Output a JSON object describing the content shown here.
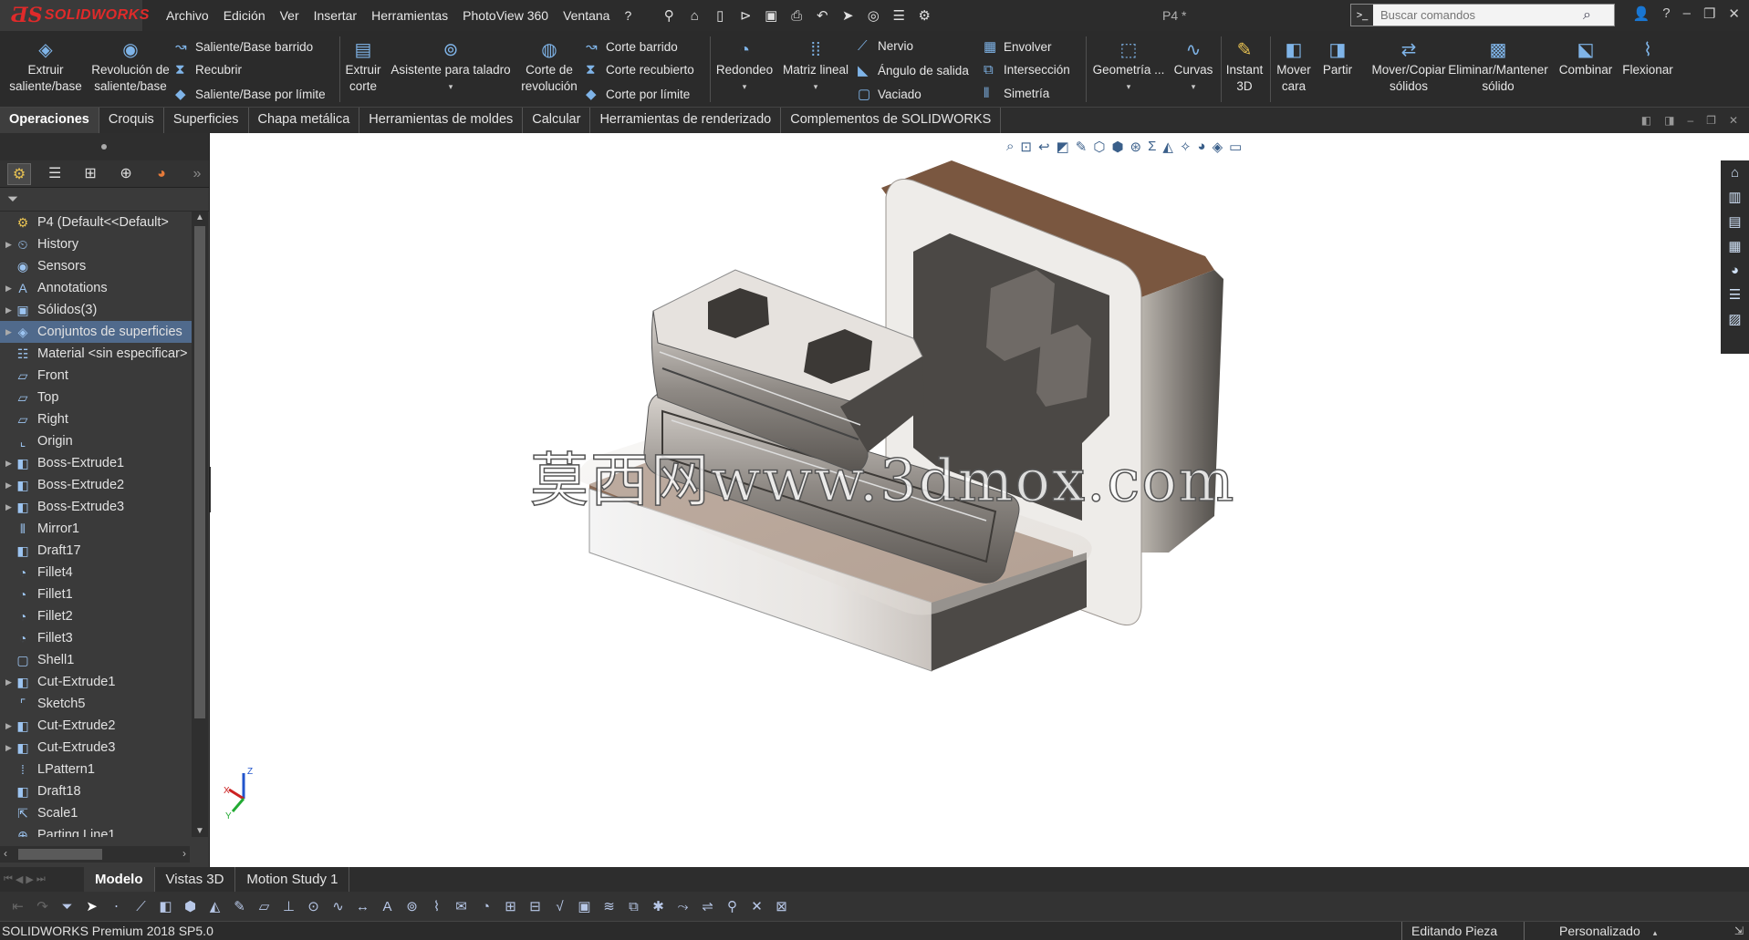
{
  "app": {
    "brand": "SOLIDWORKS",
    "document_title": "P4 *",
    "menu": [
      "Archivo",
      "Edición",
      "Ver",
      "Insertar",
      "Herramientas",
      "PhotoView 360",
      "Ventana",
      "?"
    ],
    "search_placeholder": "Buscar comandos"
  },
  "ribbon": {
    "extruir_saliente": "Extruir\nsaliente/base",
    "revolucion_saliente": "Revolución de\nsaliente/base",
    "saliente_barrido": "Saliente/Base barrido",
    "recubrir": "Recubrir",
    "saliente_limite": "Saliente/Base por límite",
    "extruir_corte": "Extruir\ncorte",
    "asistente_taladro": "Asistente para taladro",
    "corte_revolucion": "Corte de\nrevolución",
    "corte_barrido": "Corte barrido",
    "corte_recubierto": "Corte recubierto",
    "corte_limite": "Corte por límite",
    "redondeo": "Redondeo",
    "matriz_lineal": "Matriz lineal",
    "nervio": "Nervio",
    "angulo_salida": "Ángulo de salida",
    "vaciado": "Vaciado",
    "envolver": "Envolver",
    "interseccion": "Intersección",
    "simetria": "Simetría",
    "geometria": "Geometría ...",
    "curvas": "Curvas",
    "instant3d": "Instant\n3D",
    "mover_cara": "Mover\ncara",
    "partir": "Partir",
    "mover_copiar": "Mover/Copiar\nsólidos",
    "eliminar_mantener": "Eliminar/Mantener\nsólido",
    "combinar": "Combinar",
    "flexionar": "Flexionar"
  },
  "tabs": [
    "Operaciones",
    "Croquis",
    "Superficies",
    "Chapa metálica",
    "Herramientas de moldes",
    "Calcular",
    "Herramientas de renderizado",
    "Complementos de SOLIDWORKS"
  ],
  "tree": [
    {
      "label": "P4  (Default<<Default>",
      "icon": "part-icon",
      "expand": false,
      "root": true
    },
    {
      "label": "History",
      "icon": "history-icon",
      "expand": true
    },
    {
      "label": "Sensors",
      "icon": "sensor-icon",
      "expand": false
    },
    {
      "label": "Annotations",
      "icon": "annotation-icon",
      "expand": true
    },
    {
      "label": "Sólidos(3)",
      "icon": "solid-bodies-icon",
      "expand": true
    },
    {
      "label": "Conjuntos de superficies",
      "icon": "surface-bodies-icon",
      "expand": true,
      "selected": true
    },
    {
      "label": "Material <sin especificar>",
      "icon": "material-icon",
      "expand": false
    },
    {
      "label": "Front",
      "icon": "plane-icon",
      "expand": false
    },
    {
      "label": "Top",
      "icon": "plane-icon",
      "expand": false
    },
    {
      "label": "Right",
      "icon": "plane-icon",
      "expand": false
    },
    {
      "label": "Origin",
      "icon": "origin-icon",
      "expand": false
    },
    {
      "label": "Boss-Extrude1",
      "icon": "feature-icon",
      "expand": true
    },
    {
      "label": "Boss-Extrude2",
      "icon": "feature-icon",
      "expand": true
    },
    {
      "label": "Boss-Extrude3",
      "icon": "feature-icon",
      "expand": true
    },
    {
      "label": "Mirror1",
      "icon": "mirror-icon",
      "expand": false
    },
    {
      "label": "Draft17",
      "icon": "feature-icon",
      "expand": false
    },
    {
      "label": "Fillet4",
      "icon": "fillet-icon",
      "expand": false
    },
    {
      "label": "Fillet1",
      "icon": "fillet-icon",
      "expand": false
    },
    {
      "label": "Fillet2",
      "icon": "fillet-icon",
      "expand": false
    },
    {
      "label": "Fillet3",
      "icon": "fillet-icon",
      "expand": false
    },
    {
      "label": "Shell1",
      "icon": "shell-icon",
      "expand": false
    },
    {
      "label": "Cut-Extrude1",
      "icon": "feature-icon",
      "expand": true
    },
    {
      "label": "Sketch5",
      "icon": "sketch-icon",
      "expand": false
    },
    {
      "label": "Cut-Extrude2",
      "icon": "feature-icon",
      "expand": true
    },
    {
      "label": "Cut-Extrude3",
      "icon": "feature-icon",
      "expand": true
    },
    {
      "label": "LPattern1",
      "icon": "pattern-icon",
      "expand": false
    },
    {
      "label": "Draft18",
      "icon": "feature-icon",
      "expand": false
    },
    {
      "label": "Scale1",
      "icon": "scale-icon",
      "expand": false
    },
    {
      "label": "Parting Line1",
      "icon": "parting-line-icon",
      "expand": false
    }
  ],
  "viewport": {
    "watermark": "莫西网www.3dmox.com",
    "triad": {
      "x": "X",
      "y": "Y",
      "z": "Z"
    }
  },
  "bottom_tabs": [
    "Modelo",
    "Vistas 3D",
    "Motion Study 1"
  ],
  "status": {
    "product": "SOLIDWORKS Premium 2018 SP5.0",
    "mode": "Editando Pieza",
    "units": "Personalizado"
  }
}
